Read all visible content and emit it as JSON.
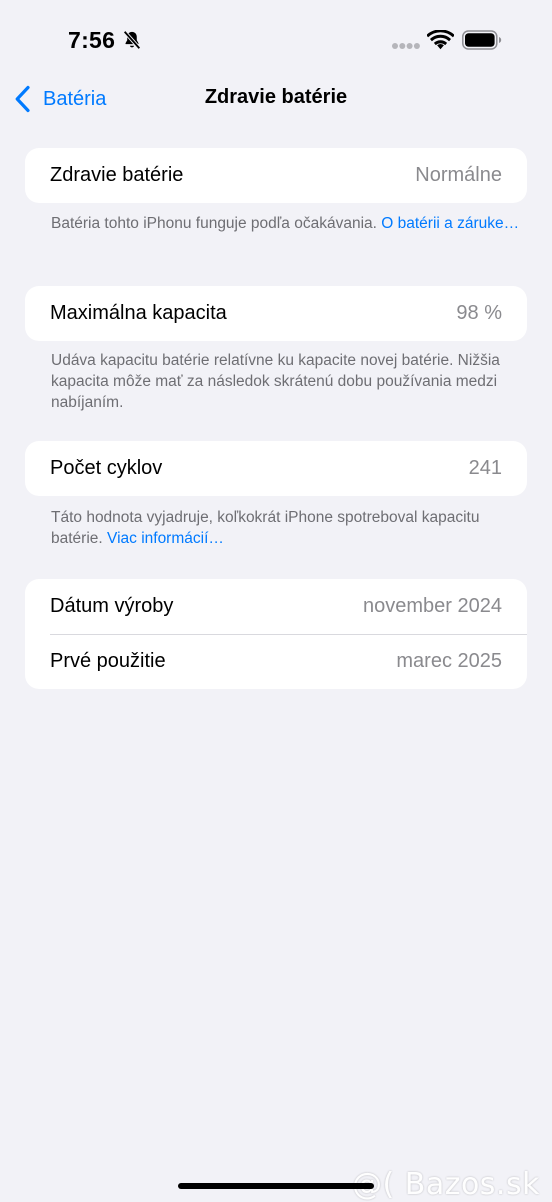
{
  "status_bar": {
    "time": "7:56"
  },
  "nav": {
    "back_label": "Batéria",
    "title": "Zdravie batérie"
  },
  "health": {
    "label": "Zdravie batérie",
    "value": "Normálne",
    "note_text": "Batéria tohto iPhonu funguje podľa očakávania. ",
    "note_link": "O batérii a záruke…"
  },
  "capacity": {
    "label": "Maximálna kapacita",
    "value": "98 %",
    "note_text": "Udáva kapacitu batérie relatívne ku kapacite novej batérie. Nižšia kapacita môže mať za následok skrátenú dobu používania medzi nabíjaním."
  },
  "cycles": {
    "label": "Počet cyklov",
    "value": "241",
    "note_text": "Táto hodnota vyjadruje, koľkokrát iPhone spotreboval kapacitu batérie. ",
    "note_link": "Viac informácií…"
  },
  "dates": {
    "manufacture_label": "Dátum výroby",
    "manufacture_value": "november 2024",
    "first_use_label": "Prvé použitie",
    "first_use_value": "marec 2025"
  },
  "watermark": "@( Bazos.sk",
  "colors": {
    "background": "#f2f2f7",
    "accent": "#007aff",
    "secondary_text": "#8a8a8e"
  }
}
